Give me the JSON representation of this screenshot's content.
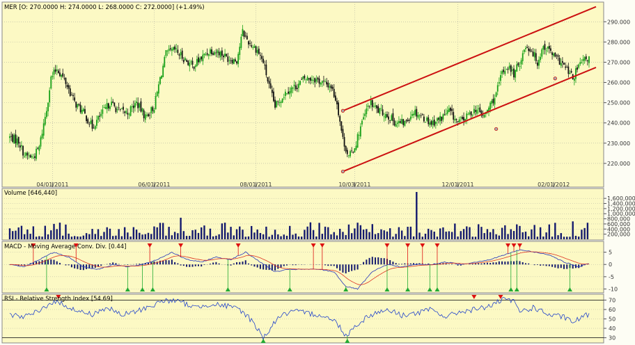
{
  "chart_data": {
    "type": "candlestick",
    "colors": {
      "panel_bg": "#fcf9c4",
      "up": "#18a018",
      "down": "#101010",
      "channel": "#cc1111",
      "volume": "#141a6e",
      "macd_line": "#2233bb",
      "signal_line": "#dd3322",
      "rsi_line": "#2244cc",
      "marker_up": "#22aa33",
      "marker_down": "#dd1111",
      "grid": "#b0b0a0"
    },
    "main": {
      "title": "MER [O: 270.0000  H: 274.0000  L: 268.0000  C: 272.0000] (+1.49%)",
      "ylim": [
        210,
        298
      ],
      "yticks": [
        "220.000",
        "230.000",
        "240.000",
        "250.000",
        "260.000",
        "270.000",
        "280.000",
        "290.000"
      ],
      "xticks": [
        "04/01/2011",
        "06/01/2011",
        "08/01/2011",
        "10/03/2011",
        "12/01/2011",
        "02/01/2012"
      ],
      "price_anchors": [
        [
          0,
          233
        ],
        [
          6,
          231
        ],
        [
          10,
          224
        ],
        [
          16,
          223
        ],
        [
          20,
          228
        ],
        [
          25,
          247
        ],
        [
          28,
          262
        ],
        [
          32,
          267
        ],
        [
          38,
          260
        ],
        [
          44,
          250
        ],
        [
          50,
          245
        ],
        [
          56,
          238
        ],
        [
          62,
          244
        ],
        [
          68,
          250
        ],
        [
          74,
          246
        ],
        [
          80,
          245
        ],
        [
          86,
          250
        ],
        [
          92,
          243
        ],
        [
          98,
          248
        ],
        [
          102,
          262
        ],
        [
          106,
          274
        ],
        [
          112,
          276
        ],
        [
          118,
          272
        ],
        [
          124,
          268
        ],
        [
          130,
          272
        ],
        [
          136,
          276
        ],
        [
          142,
          275
        ],
        [
          148,
          272
        ],
        [
          154,
          271
        ],
        [
          158,
          285
        ],
        [
          162,
          280
        ],
        [
          168,
          276
        ],
        [
          172,
          270
        ],
        [
          176,
          258
        ],
        [
          180,
          248
        ],
        [
          184,
          252
        ],
        [
          188,
          256
        ],
        [
          194,
          258
        ],
        [
          200,
          262
        ],
        [
          206,
          262
        ],
        [
          212,
          260
        ],
        [
          218,
          258
        ],
        [
          222,
          250
        ],
        [
          226,
          232
        ],
        [
          230,
          223
        ],
        [
          234,
          228
        ],
        [
          238,
          238
        ],
        [
          244,
          250
        ],
        [
          250,
          246
        ],
        [
          256,
          244
        ],
        [
          262,
          240
        ],
        [
          268,
          240
        ],
        [
          274,
          246
        ],
        [
          280,
          243
        ],
        [
          286,
          240
        ],
        [
          292,
          242
        ],
        [
          298,
          246
        ],
        [
          304,
          240
        ],
        [
          310,
          243
        ],
        [
          316,
          247
        ],
        [
          322,
          243
        ],
        [
          326,
          249
        ],
        [
          330,
          254
        ],
        [
          334,
          265
        ],
        [
          338,
          268
        ],
        [
          342,
          264
        ],
        [
          346,
          270
        ],
        [
          350,
          278
        ],
        [
          354,
          276
        ],
        [
          358,
          270
        ],
        [
          362,
          278
        ],
        [
          366,
          276
        ],
        [
          370,
          272
        ],
        [
          374,
          270
        ],
        [
          378,
          266
        ],
        [
          382,
          262
        ],
        [
          386,
          268
        ],
        [
          390,
          271
        ],
        [
          393,
          272
        ]
      ],
      "channel_upper": [
        [
          226,
          246
        ],
        [
          393,
          296
        ]
      ],
      "channel_lower": [
        [
          226,
          216
        ],
        [
          393,
          266
        ]
      ]
    },
    "volume": {
      "title": "Volume [646,440]",
      "ylim": [
        0,
        1850000
      ],
      "yticks": [
        "200,000",
        "400,000",
        "600,000",
        "800,000",
        "1,000,000",
        "1,200,000",
        "1,400,000",
        "1,600,000"
      ],
      "spikes": [
        [
          276,
          1850000
        ],
        [
          277,
          780000
        ],
        [
          383,
          700000
        ],
        [
          393,
          646440
        ]
      ]
    },
    "macd": {
      "title": "MACD - Moving Average Conv. Div. [0.44]",
      "ylim": [
        -11,
        8
      ],
      "yticks": [
        "-10",
        "-5",
        "0",
        "5"
      ],
      "anchors": [
        [
          0,
          0
        ],
        [
          10,
          -1
        ],
        [
          20,
          2
        ],
        [
          30,
          5
        ],
        [
          40,
          3
        ],
        [
          50,
          -1
        ],
        [
          60,
          -2
        ],
        [
          70,
          0
        ],
        [
          80,
          -1
        ],
        [
          90,
          0
        ],
        [
          100,
          2
        ],
        [
          110,
          5
        ],
        [
          120,
          2
        ],
        [
          130,
          1
        ],
        [
          140,
          3
        ],
        [
          150,
          2
        ],
        [
          160,
          5
        ],
        [
          170,
          1
        ],
        [
          180,
          -3
        ],
        [
          190,
          -2
        ],
        [
          200,
          -2
        ],
        [
          210,
          -2
        ],
        [
          220,
          -3
        ],
        [
          228,
          -9
        ],
        [
          236,
          -10
        ],
        [
          246,
          -3
        ],
        [
          256,
          0
        ],
        [
          266,
          -1
        ],
        [
          276,
          0
        ],
        [
          286,
          0
        ],
        [
          296,
          1
        ],
        [
          306,
          0
        ],
        [
          316,
          1
        ],
        [
          326,
          2
        ],
        [
          336,
          4
        ],
        [
          346,
          6
        ],
        [
          356,
          5
        ],
        [
          366,
          4
        ],
        [
          376,
          1
        ],
        [
          386,
          -1
        ],
        [
          393,
          0.44
        ]
      ],
      "buy_markers": [
        25,
        80,
        90,
        97,
        148,
        190,
        228,
        256,
        270,
        285,
        290,
        340,
        344,
        380
      ],
      "sell_markers": [
        16,
        45,
        95,
        116,
        155,
        206,
        212,
        256,
        270,
        280,
        290,
        338,
        342,
        346
      ]
    },
    "rsi": {
      "title": "RSI - Relative Strength Index [54.69]",
      "ylim": [
        26,
        74
      ],
      "yticks": [
        "30",
        "40",
        "50",
        "60",
        "70"
      ],
      "anchors": [
        [
          0,
          55
        ],
        [
          10,
          52
        ],
        [
          20,
          58
        ],
        [
          28,
          68
        ],
        [
          36,
          66
        ],
        [
          46,
          58
        ],
        [
          56,
          55
        ],
        [
          66,
          62
        ],
        [
          76,
          54
        ],
        [
          86,
          58
        ],
        [
          96,
          64
        ],
        [
          106,
          70
        ],
        [
          116,
          68
        ],
        [
          126,
          62
        ],
        [
          136,
          66
        ],
        [
          146,
          64
        ],
        [
          156,
          60
        ],
        [
          162,
          52
        ],
        [
          168,
          40
        ],
        [
          172,
          30
        ],
        [
          176,
          38
        ],
        [
          182,
          52
        ],
        [
          192,
          58
        ],
        [
          202,
          56
        ],
        [
          212,
          54
        ],
        [
          222,
          46
        ],
        [
          228,
          32
        ],
        [
          234,
          42
        ],
        [
          244,
          54
        ],
        [
          256,
          60
        ],
        [
          266,
          54
        ],
        [
          276,
          56
        ],
        [
          286,
          60
        ],
        [
          296,
          52
        ],
        [
          306,
          58
        ],
        [
          316,
          60
        ],
        [
          326,
          64
        ],
        [
          336,
          71
        ],
        [
          342,
          68
        ],
        [
          346,
          58
        ],
        [
          356,
          62
        ],
        [
          366,
          54
        ],
        [
          376,
          52
        ],
        [
          382,
          46
        ],
        [
          388,
          52
        ],
        [
          393,
          54.69
        ]
      ],
      "buy_markers": [
        172,
        229
      ],
      "sell_markers": [
        33,
        315,
        333
      ]
    }
  }
}
